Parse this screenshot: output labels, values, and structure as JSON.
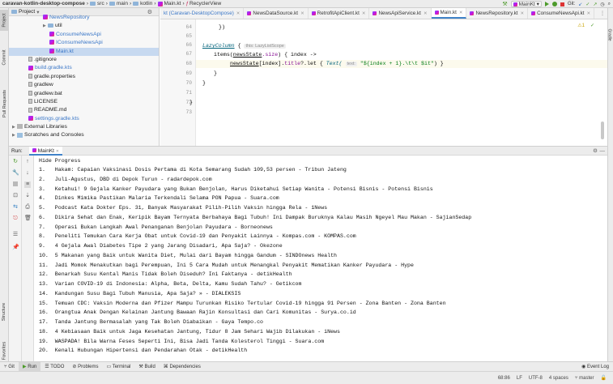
{
  "navbar": {
    "project": "caravan-kotlin-desktop-compose",
    "breadcrumbs": [
      "src",
      "main",
      "kotlin",
      "Main.kt",
      "RecyclerView"
    ],
    "run_config": "MainKt",
    "git_label": "Git:"
  },
  "project_panel": {
    "title": "Project",
    "items": [
      {
        "label": "NewsRepository",
        "type": "kotlin"
      },
      {
        "label": "util",
        "type": "folder"
      },
      {
        "label": "ConsumeNewsApi",
        "type": "kotlin"
      },
      {
        "label": "IConsumeNewsApi",
        "type": "kotlin"
      },
      {
        "label": "Main.kt",
        "type": "kotlin"
      },
      {
        "label": ".gitignore",
        "type": "file"
      },
      {
        "label": "build.gradle.kts",
        "type": "file"
      },
      {
        "label": "gradle.properties",
        "type": "file"
      },
      {
        "label": "gradlew",
        "type": "file"
      },
      {
        "label": "gradlew.bat",
        "type": "file"
      },
      {
        "label": "LICENSE",
        "type": "file"
      },
      {
        "label": "README.md",
        "type": "file"
      },
      {
        "label": "settings.gradle.kts",
        "type": "file"
      },
      {
        "label": "External Libraries",
        "type": "folder"
      },
      {
        "label": "Scratches and Consoles",
        "type": "folder"
      }
    ]
  },
  "left_stripe": [
    "Project",
    "Commit",
    "Pull Requests",
    "Structure",
    "Favorites"
  ],
  "right_stripe": "Gradle",
  "editor_tabs": [
    {
      "label": "kt (Caravan-DesktopCompose)",
      "active": false
    },
    {
      "label": "NewsDataSource.kt",
      "active": false
    },
    {
      "label": "RetrofitApiClient.kt",
      "active": false
    },
    {
      "label": "NewsApiService.kt",
      "active": false
    },
    {
      "label": "Main.kt",
      "active": true
    },
    {
      "label": "NewsRepository.kt",
      "active": false
    },
    {
      "label": "ConsumeNewsApi.kt",
      "active": false
    }
  ],
  "editor": {
    "line_numbers": [
      "64",
      "65",
      "66",
      "67",
      "68",
      "69",
      "70",
      "71",
      "72",
      "73"
    ],
    "code_tokens": {
      "close_brace_paren": "})",
      "lazy_column": "LazyColumn",
      "brace_open": " {",
      "hint_scope": "this: LazyListScope",
      "items_call": "items(",
      "news_state": "newsState",
      "size_prop": ".size",
      "items_rest": ") { index ->",
      "news_state_idx": "[index].",
      "title_prop": "title",
      "let_call": "?.let { ",
      "text_call": "Text(",
      "hint_text": "text:",
      "str_literal": "\"${index + 1}.\\t\\t $it\"",
      "close_call": ") }",
      "close_brace": "}"
    },
    "warning_count": "1"
  },
  "run_panel": {
    "label": "Run:",
    "config": "MainKt",
    "output_header": "Hide Progress",
    "lines": [
      "1.   Hakam: Capaian Vaksinasi Dosis Pertama di Kota Semarang Sudah 109,53 persen - Tribun Jateng",
      "2.   Juli-Agustus, DBD di Depok Turun - radardepok.com",
      "3.   Ketahui! 9 Gejala Kanker Payudara yang Bukan Benjolan, Harus Diketahui Setiap Wanita - Potensi Bisnis - Potensi Bisnis",
      "4.   Dinkes Mimika Pastikan Malaria Terkendali Selama PON Papua - Suara.com",
      "5.   Podcast Kata Dokter Eps. 31, Banyak Masyarakat Pilih-Pilih Vaksin hingga Rela - 1News",
      "6.   Dikira Sehat dan Enak, Keripik Bayam Ternyata Berbahaya Bagi Tubuh! Ini Dampak Buruknya Kalau Masih Ngeyel Mau Makan - SajianSedap",
      "7.   Operasi Bukan Langkah Awal Penanganan Benjolan Payudara - Borneonews",
      "8.   Peneliti Temukan Cara Kerja Obat untuk Covid-19 dan Penyakit Lainnya - Kompas.com - KOMPAS.com",
      "9.   4 Gejala Awal Diabetes Tipe 2 yang Jarang Disadari, Apa Saja? - Okezone",
      "10.  5 Makanan yang Baik untuk Wanita Diet, Mulai dari Bayam hingga Gandum - SINDOnews Health",
      "11.  Jadi Momok Menakutkan bagi Perempuan, Ini 5 Cara Mudah untuk Menangkal Penyakit Mematikan Kanker Payudara - Hype",
      "12.  Benarkah Susu Kental Manis Tidak Boleh Diseduh? Ini Faktanya - detikHealth",
      "13.  Varian COVID-19 di Indonesia: Alpha, Beta, Delta, Kamu Sudah Tahu? - Getikcom",
      "14.  Kandungan Susu Bagi Tubuh Manusia, Apa Saja? » - DIALEKSIS",
      "15.  Temuan CDC: Vaksin Moderna dan Pfizer Mampu Turunkan Risiko Tertular Covid-19 hingga 91 Persen - Zona Banten - Zona Banten",
      "16.  Orangtua Anak Dengan Kelainan Jantung Bawaan Rajin Konsultasi dan Cari Komunitas - Surya.co.id",
      "17.  Tanda Jantung Bermasalah yang Tak Boleh Diabaikan - Gaya Tempo.co",
      "18.  4 Kebiasaan Baik untuk Jaga Kesehatan Jantung, Tidur 8 Jam Sehari Wajib Dilakukan - iNews",
      "19.  WASPADA! Bila Warna Feses Seperti Ini, Bisa Jadi Tanda Kolesterol Tinggi - Suara.com",
      "20.  Kenali Hubungan Hipertensi dan Pendarahan Otak - detikHealth"
    ]
  },
  "bottom_tabs": [
    {
      "label": "Git",
      "active": false
    },
    {
      "label": "Run",
      "active": true
    },
    {
      "label": "TODO",
      "active": false
    },
    {
      "label": "Problems",
      "active": false
    },
    {
      "label": "Terminal",
      "active": false
    },
    {
      "label": "Build",
      "active": false
    },
    {
      "label": "Dependencies",
      "active": false
    }
  ],
  "event_log": "Event Log",
  "status_bar": {
    "position": "68:86",
    "line_sep": "LF",
    "encoding": "UTF-8",
    "indent": "4 spaces",
    "branch": "master"
  }
}
